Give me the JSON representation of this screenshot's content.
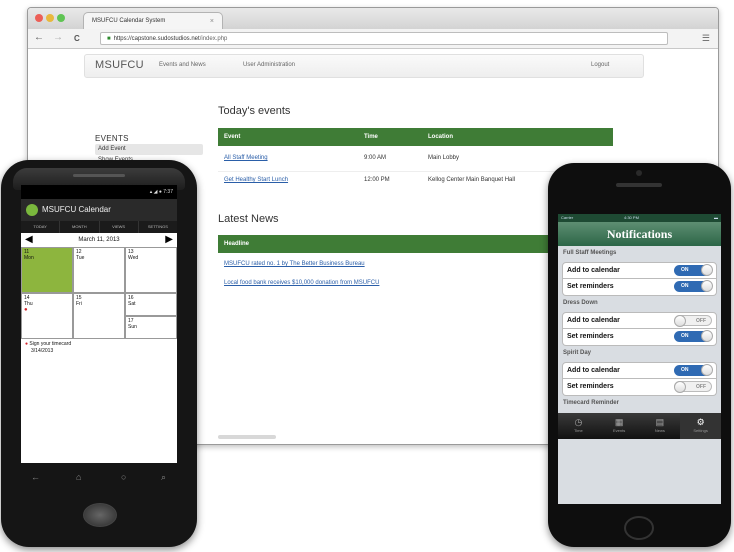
{
  "browser": {
    "tab_title": "MSUFCU Calendar System",
    "url_host": "https://capstone.sudostudios.net",
    "url_path": "/index.php",
    "back": "←",
    "forward": "→",
    "reload": "C",
    "menu": "☰"
  },
  "site": {
    "brand": "MSUFCU",
    "nav": [
      "Events and News",
      "User Administration"
    ],
    "logout": "Logout",
    "todays_events_heading": "Today's events",
    "sidebar_heading": "EVENTS",
    "sidebar_items": [
      "Add Event",
      "Show Events"
    ],
    "events_table": {
      "headers": [
        "Event",
        "Time",
        "Location"
      ],
      "rows": [
        [
          "All Staff Meeting",
          "9:00 AM",
          "Main Lobby"
        ],
        [
          "Get Healthy Start Lunch",
          "12:00 PM",
          "Kellog Center Main Banquet Hall"
        ]
      ]
    },
    "latest_news_heading": "Latest News",
    "news_table": {
      "header": "Headline",
      "rows": [
        "MSUFCU rated no. 1 by The Better Business Bureau",
        "Local food bank receives $10,000 donation from MSUFCU"
      ]
    }
  },
  "android": {
    "status_time": "7:37",
    "app_title": "MSUFCU Calendar",
    "tabs": [
      "TODAY",
      "MONTH",
      "VIEWS",
      "SETTINGS"
    ],
    "date": "March 11, 2013",
    "days": [
      {
        "num": "11",
        "name": "Mon"
      },
      {
        "num": "12",
        "name": "Tue"
      },
      {
        "num": "13",
        "name": "Wed"
      },
      {
        "num": "14",
        "name": "Thu"
      },
      {
        "num": "15",
        "name": "Fri"
      },
      {
        "num": "16",
        "name": "Sat"
      },
      {
        "num": "17",
        "name": "Sun"
      }
    ],
    "event_title": "Sign your timecard",
    "event_date": "3/14/2013"
  },
  "iphone": {
    "status_carrier": "Carrier",
    "status_time": "4:30 PM",
    "title": "Notifications",
    "sections": [
      {
        "title": "Full Staff Meetings",
        "rows": [
          {
            "label": "Add to calendar",
            "state": "ON"
          },
          {
            "label": "Set reminders",
            "state": "ON"
          }
        ]
      },
      {
        "title": "Dress Down",
        "rows": [
          {
            "label": "Add to calendar",
            "state": "OFF"
          },
          {
            "label": "Set reminders",
            "state": "ON"
          }
        ]
      },
      {
        "title": "Spirit Day",
        "rows": [
          {
            "label": "Add to calendar",
            "state": "ON"
          },
          {
            "label": "Set reminders",
            "state": "OFF"
          }
        ]
      },
      {
        "title": "Timecard Reminder",
        "rows": []
      }
    ],
    "tabbar": [
      "Time",
      "Events",
      "News",
      "Settings"
    ]
  },
  "colors": {
    "table_header": "#3f7c36",
    "android_selected_day": "#8db53e",
    "ios_toggle_on": "#2f6ab3",
    "ios_nav": "#2c6647",
    "link": "#2a5ea8"
  }
}
